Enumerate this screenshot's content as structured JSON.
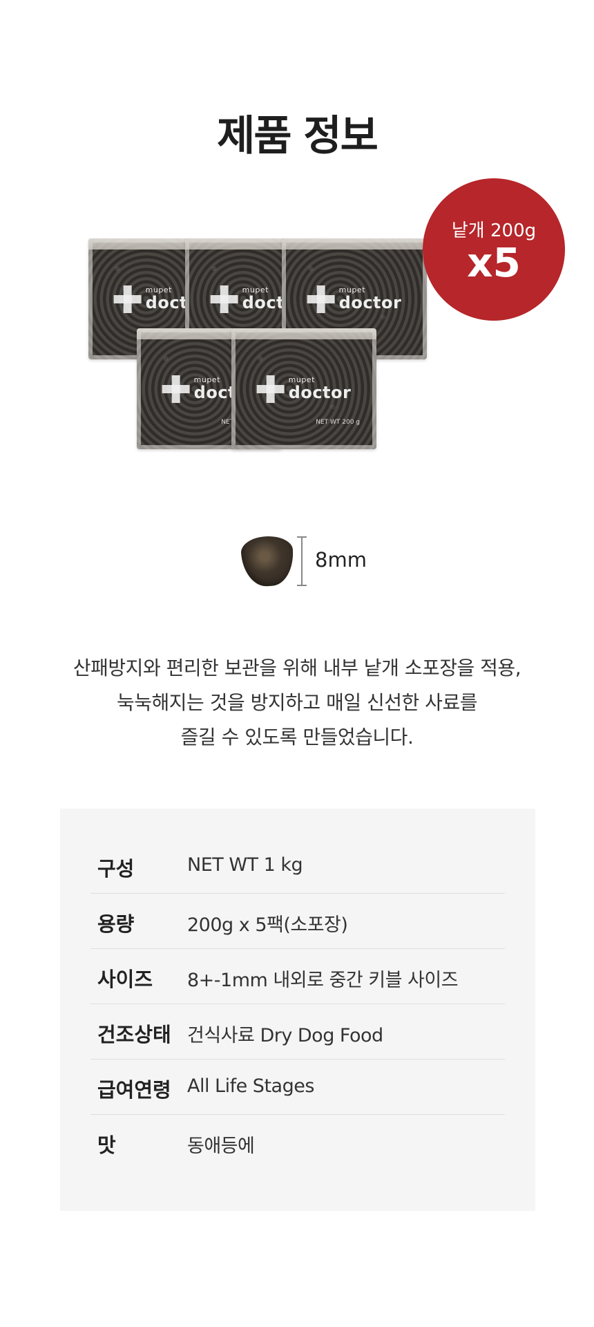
{
  "title": "제품 정보",
  "product_image": {
    "brand_small": "mupet",
    "brand_big": "doctor",
    "net_wt_label": "NET WT 200 g"
  },
  "badge": {
    "line1": "낱개 200g",
    "line2": "x5",
    "color": "#b6262a"
  },
  "kibble": {
    "size_label": "8mm"
  },
  "description": [
    "산패방지와 편리한 보관을 위해 내부 낱개 소포장을 적용,",
    "눅눅해지는 것을 방지하고 매일 신선한 사료를",
    "즐길 수 있도록 만들었습니다."
  ],
  "spec_table": [
    {
      "label": "구성",
      "value": "NET WT 1 kg"
    },
    {
      "label": "용량",
      "value": "200g x 5팩(소포장)"
    },
    {
      "label": "사이즈",
      "value": "8+-1mm 내외로 중간 키블 사이즈"
    },
    {
      "label": "건조상태",
      "value": "건식사료 Dry Dog Food"
    },
    {
      "label": "급여연령",
      "value": "All Life Stages"
    },
    {
      "label": "맛",
      "value": "동애등에"
    }
  ]
}
